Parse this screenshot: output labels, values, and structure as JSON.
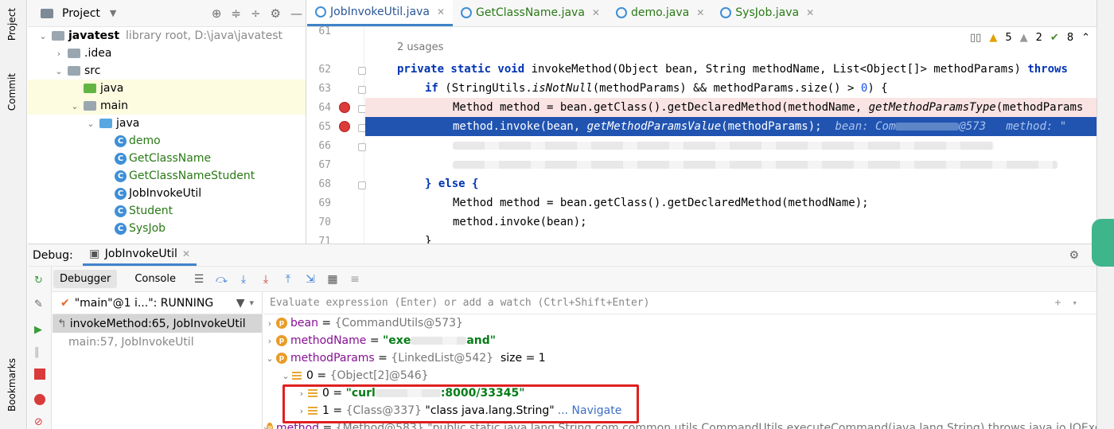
{
  "left_strip": {
    "project": "Project",
    "commit": "Commit",
    "bookmarks": "Bookmarks"
  },
  "project_panel": {
    "title": "Project",
    "tree": [
      {
        "label": "javatest",
        "note": "library root,  D:\\java\\javatest",
        "indent": 0,
        "kind": "folder",
        "chev": "v"
      },
      {
        "label": ".idea",
        "indent": 1,
        "kind": "folder",
        "chev": ">"
      },
      {
        "label": "src",
        "indent": 1,
        "kind": "folder",
        "chev": "v"
      },
      {
        "label": "java",
        "indent": 2,
        "kind": "folder-green",
        "chev": ""
      },
      {
        "label": "main",
        "indent": 2,
        "kind": "folder",
        "chev": "v"
      },
      {
        "label": "java",
        "indent": 3,
        "kind": "folder-blue",
        "chev": "v"
      },
      {
        "label": "demo",
        "indent": 4,
        "kind": "class",
        "chev": ""
      },
      {
        "label": "GetClassName",
        "indent": 4,
        "kind": "class",
        "chev": ""
      },
      {
        "label": "GetClassNameStudent",
        "indent": 4,
        "kind": "class",
        "chev": ""
      },
      {
        "label": "JobInvokeUtil",
        "indent": 4,
        "kind": "class-black",
        "chev": ""
      },
      {
        "label": "Student",
        "indent": 4,
        "kind": "class",
        "chev": ""
      },
      {
        "label": "SysJob",
        "indent": 4,
        "kind": "class",
        "chev": ""
      }
    ]
  },
  "editor": {
    "tabs": [
      {
        "label": "JobInvokeUtil.java",
        "active": true
      },
      {
        "label": "GetClassName.java",
        "active": false
      },
      {
        "label": "demo.java",
        "active": false
      },
      {
        "label": "SysJob.java",
        "active": false
      }
    ],
    "usages": "2 usages",
    "inspections": {
      "warnings": "5",
      "weak": "2",
      "ok": "8"
    },
    "lines": {
      "l61": "61",
      "l62": "62",
      "l63": "63",
      "l64": "64",
      "l65": "65",
      "l66": "66",
      "l67": "67",
      "l68": "68",
      "l69": "69",
      "l70": "70",
      "l71": "71"
    },
    "code": {
      "c62_pre": "private static void ",
      "c62_name": "invokeMethod(Object bean, String methodName, List<Object[]> methodParams) ",
      "c62_throws": "throws",
      "c63_if": "if",
      "c63_a": " (StringUtils.",
      "c63_it": "isNotNull",
      "c63_b": "(methodParams) && methodParams.size() > ",
      "c63_num": "0",
      "c63_c": ") {",
      "c64_a": "Method method = bean.getClass().getDeclaredMethod(methodName, ",
      "c64_it": "getMethodParamsType",
      "c64_b": "(methodParams",
      "c65_a": "method.invoke(bean, ",
      "c65_it": "getMethodParamsValue",
      "c65_b": "(methodParams);",
      "c65_inlay1": "bean: Com",
      "c65_inlay2": "@573",
      "c65_inlay3": "method: \"",
      "c68_else": "} else {",
      "c69": "Method method = bean.getClass().getDeclaredMethod(methodName);",
      "c70": "method.invoke(bean);",
      "c71": "}"
    }
  },
  "debug": {
    "label": "Debug:",
    "session_tab": "JobInvokeUtil",
    "debugger_tab": "Debugger",
    "console_tab": "Console",
    "thread": "\"main\"@1 i...\": RUNNING",
    "frames": [
      "invokeMethod:65, JobInvokeUtil",
      "main:57, JobInvokeUtil"
    ],
    "watch_placeholder": "Evaluate expression (Enter) or add a watch (Ctrl+Shift+Enter)",
    "vars": {
      "bean_name": "bean",
      "bean_val": "{CommandUtils@573}",
      "mname_name": "methodName",
      "mname_val_a": "\"exe",
      "mname_val_b": "and\"",
      "mparams_name": "methodParams",
      "mparams_type": "{LinkedList@542}",
      "mparams_size": "size = 1",
      "arr_name": "0",
      "arr_val": "{Object[2]@546}",
      "e0_name": "0",
      "e0_val_a": "\"curl",
      "e0_val_b": ":8000/33345\"",
      "e1_name": "1",
      "e1_type": "{Class@337}",
      "e1_val": "\"class java.lang.String\"",
      "e1_nav": "... Navigate",
      "method_name": "method",
      "method_val": "{Method@583} \"public static java.lang.String com.common.utils.CommandUtils.executeCommand(java.lang.String) throws java.io.IOExceptio"
    }
  }
}
